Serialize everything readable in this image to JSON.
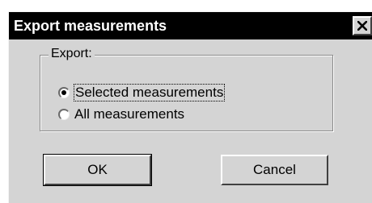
{
  "dialog": {
    "title": "Export measurements",
    "close_icon": "close-icon"
  },
  "group": {
    "legend": "Export:",
    "options": [
      {
        "label": "Selected measurements",
        "selected": true,
        "focused": true
      },
      {
        "label": "All measurements",
        "selected": false,
        "focused": false
      }
    ]
  },
  "buttons": {
    "ok_label": "OK",
    "cancel_label": "Cancel"
  },
  "colors": {
    "titlebar": "#000000",
    "title_text": "#ffffff",
    "dialog_face": "#d4d4d4"
  }
}
